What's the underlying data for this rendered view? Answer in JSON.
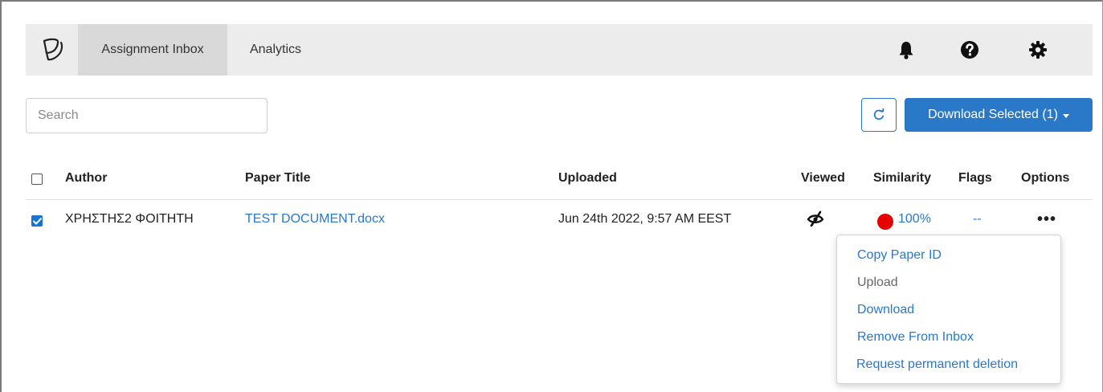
{
  "nav": {
    "tabs": [
      {
        "label": "Assignment Inbox",
        "active": true
      },
      {
        "label": "Analytics",
        "active": false
      }
    ],
    "icons": [
      "bell-icon",
      "help-icon",
      "gear-icon"
    ]
  },
  "toolbar": {
    "search_placeholder": "Search",
    "download_label": "Download Selected (1)"
  },
  "table": {
    "columns": [
      "Author",
      "Paper Title",
      "Uploaded",
      "Viewed",
      "Similarity",
      "Flags",
      "Options"
    ],
    "rows": [
      {
        "selected": true,
        "author": "ΧΡΗΣΤΗΣ2 ΦΟΙΤΗΤΗ",
        "title": "TEST DOCUMENT.docx",
        "uploaded": "Jun 24th 2022, 9:57 AM EEST",
        "viewed": "not-viewed-icon",
        "similarity": "100%",
        "flags": "--",
        "options": "•••"
      }
    ]
  },
  "options_menu": {
    "items": [
      {
        "label": "Copy Paper ID",
        "enabled": true
      },
      {
        "label": "Upload",
        "enabled": false
      },
      {
        "label": "Download",
        "enabled": true
      },
      {
        "label": "Remove From Inbox",
        "enabled": true
      },
      {
        "label": "Request permanent deletion",
        "enabled": true,
        "highlighted": true
      }
    ]
  },
  "colors": {
    "accent": "#2a78c8",
    "similarity_dot": "#e60000",
    "highlight": "#f7f72a",
    "nav_bg": "#ececec"
  }
}
